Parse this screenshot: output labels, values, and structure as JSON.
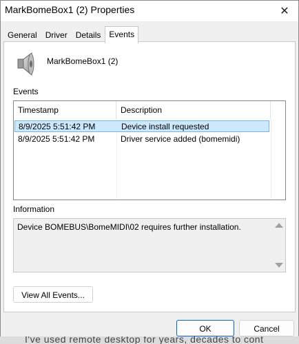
{
  "window": {
    "title": "MarkBomeBox1 (2) Properties",
    "close_glyph": "✕"
  },
  "tabs": [
    {
      "label": "General"
    },
    {
      "label": "Driver"
    },
    {
      "label": "Details"
    },
    {
      "label": "Events",
      "active": true
    }
  ],
  "device": {
    "name": "MarkBomeBox1 (2)",
    "icon": "speaker-icon"
  },
  "events": {
    "label": "Events",
    "columns": [
      "Timestamp",
      "Description"
    ],
    "rows": [
      {
        "timestamp": "8/9/2025 5:51:42 PM",
        "description": "Device install requested",
        "selected": true
      },
      {
        "timestamp": "8/9/2025 5:51:42 PM",
        "description": "Driver service added (bomemidi)"
      }
    ]
  },
  "information": {
    "label": "Information",
    "text": "Device BOMEBUS\\BomeMIDI\\02 requires further installation."
  },
  "buttons": {
    "view_all": "View All Events...",
    "ok": "OK",
    "cancel": "Cancel"
  },
  "background_text": "I've used remote desktop for years, decades to cont",
  "colors": {
    "selection": "#cce8ff",
    "selection_border": "#7fb2e0",
    "ok_border": "#0067c0"
  }
}
